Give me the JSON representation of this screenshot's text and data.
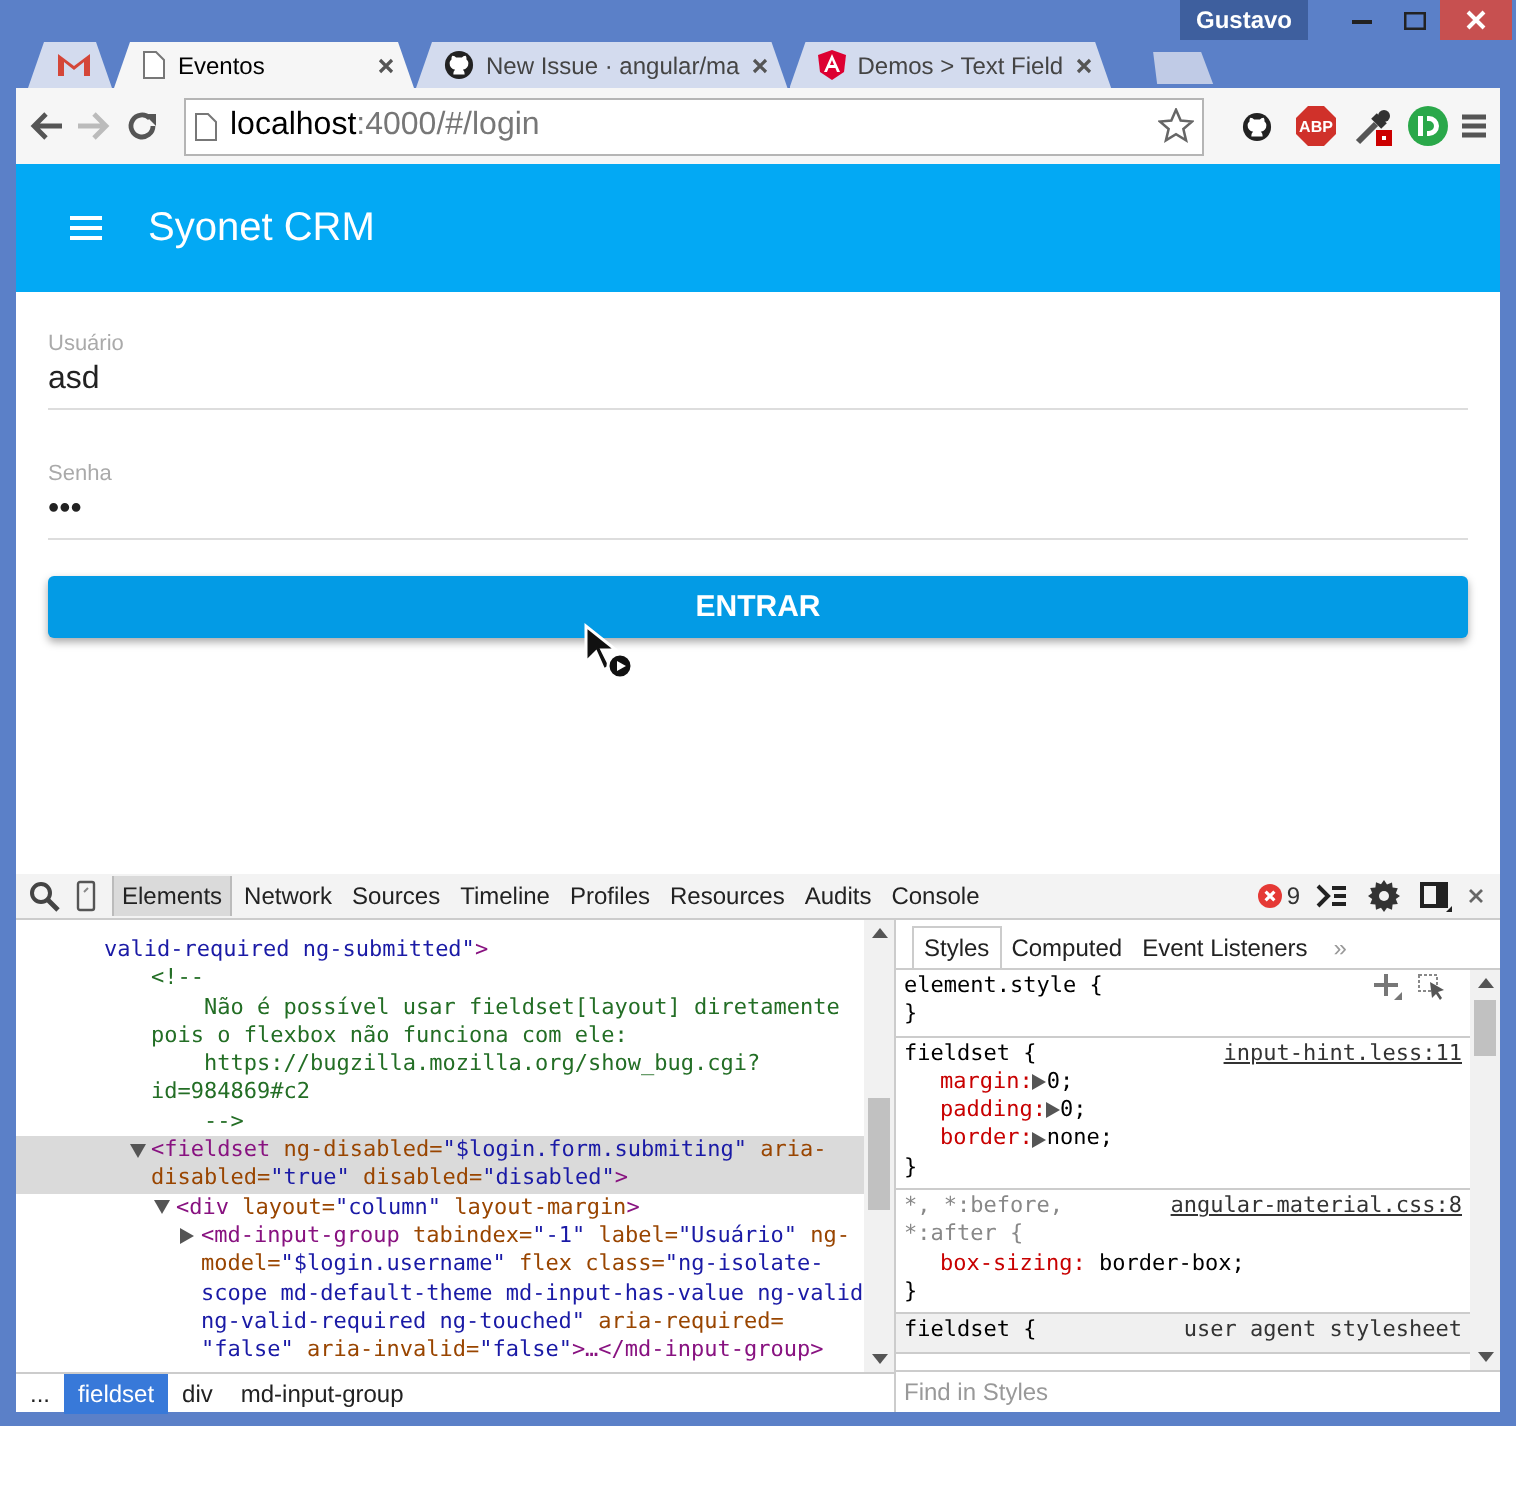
{
  "window": {
    "user": "Gustavo"
  },
  "tabs": [
    {
      "kind": "mail",
      "selected": false
    },
    {
      "kind": "page",
      "title": "Eventos",
      "selected": true
    },
    {
      "kind": "octocat",
      "title": "New Issue · angular/ma",
      "selected": false
    },
    {
      "kind": "shield",
      "title": "Demos > Text Field",
      "selected": false
    }
  ],
  "toolbar": {
    "back": {
      "disabled": false
    },
    "forward": {
      "disabled": true
    },
    "address": {
      "host": "localhost",
      "path": ":4000/#/login"
    },
    "extensions": [
      {
        "kind": "github"
      },
      {
        "kind": "abp",
        "label": "ABP"
      },
      {
        "kind": "eyedropper"
      },
      {
        "kind": "id-badge"
      }
    ]
  },
  "app": {
    "title": "Syonet CRM",
    "fields": [
      {
        "label": "Usuário",
        "value": "asd"
      },
      {
        "label": "Senha",
        "value": "•••"
      }
    ],
    "submit": "ENTRAR"
  },
  "devtools": {
    "panels": [
      {
        "label": "Elements",
        "selected": true
      },
      {
        "label": "Network",
        "selected": false
      },
      {
        "label": "Sources",
        "selected": false
      },
      {
        "label": "Timeline",
        "selected": false
      },
      {
        "label": "Profiles",
        "selected": false
      },
      {
        "label": "Resources",
        "selected": false
      },
      {
        "label": "Audits",
        "selected": false
      },
      {
        "label": "Console",
        "selected": false
      }
    ],
    "error_count": "9",
    "tree": {
      "kind": "tail",
      "selected": false,
      "lines": [
        [
          {
            "kind": "value",
            "text": "valid-required ng-submitted\""
          },
          {
            "kind": "tag",
            "text": ">"
          }
        ]
      ],
      "children": [
        {
          "kind": "comment",
          "selected": false,
          "lines": [
            [
              {
                "kind": "comment",
                "text": "<!--"
              }
            ],
            [
              {
                "kind": "comment",
                "text": "    Não é possível usar fieldset[layout] diretamente"
              }
            ],
            [
              {
                "kind": "comment",
                "text": "pois o flexbox não funciona com ele:"
              }
            ],
            [
              {
                "kind": "comment",
                "text": "    https://bugzilla.mozilla.org/show_bug.cgi?"
              }
            ],
            [
              {
                "kind": "comment",
                "text": "id=984869#c2"
              }
            ],
            [
              {
                "kind": "comment",
                "text": "    -->"
              }
            ]
          ]
        },
        {
          "kind": "element",
          "expanded": true,
          "selected": true,
          "lines": [
            [
              {
                "kind": "tag",
                "text": "<fieldset"
              },
              {
                "kind": "attr",
                "text": " ng-disabled="
              },
              {
                "kind": "value",
                "text": "\"$login.form.submiting\""
              },
              {
                "kind": "attr",
                "text": " aria-"
              }
            ],
            [
              {
                "kind": "attr",
                "text": "disabled="
              },
              {
                "kind": "value",
                "text": "\"true\""
              },
              {
                "kind": "attr",
                "text": " disabled="
              },
              {
                "kind": "value",
                "text": "\"disabled\""
              },
              {
                "kind": "tag",
                "text": ">"
              }
            ]
          ],
          "children": [
            {
              "kind": "element",
              "expanded": true,
              "selected": false,
              "lines": [
                [
                  {
                    "kind": "tag",
                    "text": "<div"
                  },
                  {
                    "kind": "attr",
                    "text": " layout="
                  },
                  {
                    "kind": "value",
                    "text": "\"column\""
                  },
                  {
                    "kind": "attr",
                    "text": " layout-margin"
                  },
                  {
                    "kind": "tag",
                    "text": ">"
                  }
                ]
              ],
              "children": [
                {
                  "kind": "element",
                  "expanded": false,
                  "selected": false,
                  "lines": [
                    [
                      {
                        "kind": "tag",
                        "text": "<md-input-group"
                      },
                      {
                        "kind": "attr",
                        "text": " tabindex="
                      },
                      {
                        "kind": "value",
                        "text": "\"-1\""
                      },
                      {
                        "kind": "attr",
                        "text": " label="
                      },
                      {
                        "kind": "value",
                        "text": "\"Usuário\""
                      },
                      {
                        "kind": "attr",
                        "text": " ng-"
                      }
                    ],
                    [
                      {
                        "kind": "attr",
                        "text": "model="
                      },
                      {
                        "kind": "value",
                        "text": "\"$login.username\""
                      },
                      {
                        "kind": "attr",
                        "text": " flex class="
                      },
                      {
                        "kind": "value",
                        "text": "\"ng-isolate-"
                      }
                    ],
                    [
                      {
                        "kind": "value",
                        "text": "scope md-default-theme md-input-has-value ng-valid"
                      }
                    ],
                    [
                      {
                        "kind": "value",
                        "text": "ng-valid-required ng-touched\""
                      },
                      {
                        "kind": "attr",
                        "text": " aria-required="
                      }
                    ],
                    [
                      {
                        "kind": "value",
                        "text": "\"false\""
                      },
                      {
                        "kind": "attr",
                        "text": " aria-invalid="
                      },
                      {
                        "kind": "value",
                        "text": "\"false\""
                      },
                      {
                        "kind": "tag",
                        "text": ">…</md-input-group>"
                      }
                    ]
                  ]
                }
              ]
            }
          ]
        }
      ]
    },
    "breadcrumbs": [
      {
        "label": "...",
        "selected": false
      },
      {
        "label": "fieldset",
        "selected": true
      },
      {
        "label": "div",
        "selected": false
      },
      {
        "label": "md-input-group",
        "selected": false
      }
    ],
    "styles": {
      "tabs": [
        {
          "label": "Styles",
          "selected": true
        },
        {
          "label": "Computed",
          "selected": false
        },
        {
          "label": "Event Listeners",
          "selected": false
        }
      ],
      "more": "»",
      "rules": [
        {
          "kind": "inline",
          "dimmed": false,
          "selector": [
            "element.style {"
          ],
          "close": "}"
        },
        {
          "kind": "author",
          "dimmed": false,
          "selector": [
            "fieldset {"
          ],
          "source": "input-hint.less:11",
          "props": [
            {
              "name": "margin:",
              "value": "0;",
              "expandable": true
            },
            {
              "name": "padding:",
              "value": "0;",
              "expandable": true
            },
            {
              "name": "border:",
              "value": "none;",
              "expandable": true
            }
          ],
          "close": "}"
        },
        {
          "kind": "author",
          "dimmed": true,
          "selector": [
            "*, *:before,",
            "*:after {"
          ],
          "source": "angular-material.css:8",
          "props": [
            {
              "name": "box-sizing:",
              "value": " border-box;",
              "expandable": false
            }
          ],
          "close": "}"
        },
        {
          "kind": "user-agent",
          "dimmed": false,
          "selector": [
            "fieldset {"
          ],
          "source": "user agent stylesheet"
        }
      ],
      "filter": {
        "placeholder": "Find in Styles"
      }
    }
  }
}
